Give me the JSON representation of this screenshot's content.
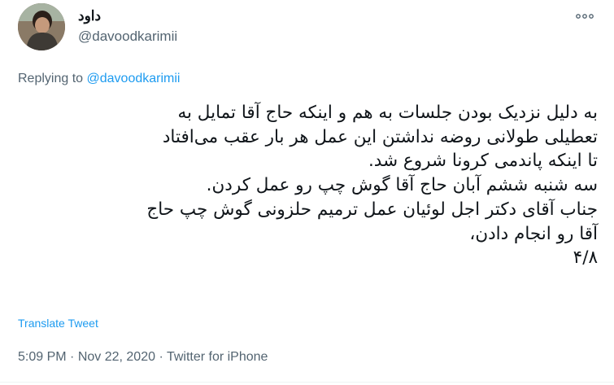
{
  "tweet": {
    "author_name": "داود",
    "author_handle": "@davoodkarimii",
    "replying_prefix": "Replying to ",
    "replying_handle": "@davoodkarimii",
    "lines": [
      "به دلیل نزدیک بودن جلسات به هم و اینکه حاج آقا تمایل به",
      "تعطیلی طولانی روضه نداشتن این عمل هر بار عقب می‌افتاد",
      "تا اینکه پاندمی کرونا شروع شد.",
      "سه شنبه ششم آبان حاج آقا گوش چپ رو عمل کردن.",
      "جناب آقای دکتر اجل لوئیان عمل ترمیم حلزونی گوش چپ حاج",
      "آقا رو انجام دادن،",
      "۴/۸"
    ],
    "translate_label": "Translate Tweet",
    "time": "5:09 PM",
    "date": "Nov 22, 2020",
    "source": "Twitter for iPhone",
    "separator": " · "
  },
  "icons": {
    "more": "more-horizontal-icon",
    "avatar": "profile-photo"
  },
  "colors": {
    "accent": "#1d9bf0",
    "secondary_text": "#536471",
    "primary_text": "#0f1419"
  }
}
